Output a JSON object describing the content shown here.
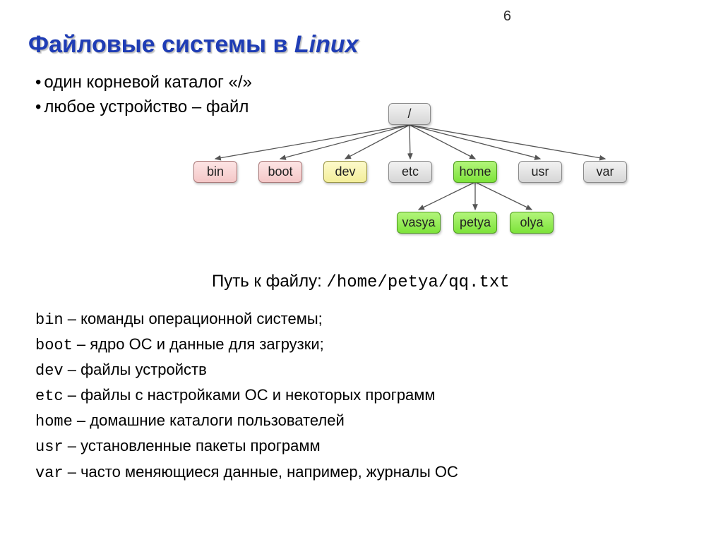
{
  "page_number": "6",
  "title_a": "Файловые системы в ",
  "title_b": "Linux",
  "bullets": {
    "b1": "один корневой каталог «/»",
    "b2": "любое устройство – файл"
  },
  "nodes": {
    "root": "/",
    "bin": "bin",
    "boot": "boot",
    "dev": "dev",
    "etc": "etc",
    "home": "home",
    "usr": "usr",
    "var": "var",
    "vasya": "vasya",
    "petya": "petya",
    "olya": "olya"
  },
  "path": {
    "label": "Путь к файлу: ",
    "value": "/home/petya/qq.txt"
  },
  "defs": {
    "bin": {
      "term": "bin",
      "desc": " – команды операционной системы;"
    },
    "boot": {
      "term": "boot",
      "desc": " – ядро ОС и данные для загрузки;"
    },
    "dev": {
      "term": "dev",
      "desc": " – файлы устройств"
    },
    "etc": {
      "term": "etc",
      "desc": " – файлы с настройками ОС и некоторых программ"
    },
    "home": {
      "term": "home",
      "desc": " – домашние каталоги пользователей"
    },
    "usr": {
      "term": "usr",
      "desc": " – установленные пакеты программ"
    },
    "var": {
      "term": "var",
      "desc": " – часто меняющиеся данные,  например, журналы ОС"
    }
  }
}
